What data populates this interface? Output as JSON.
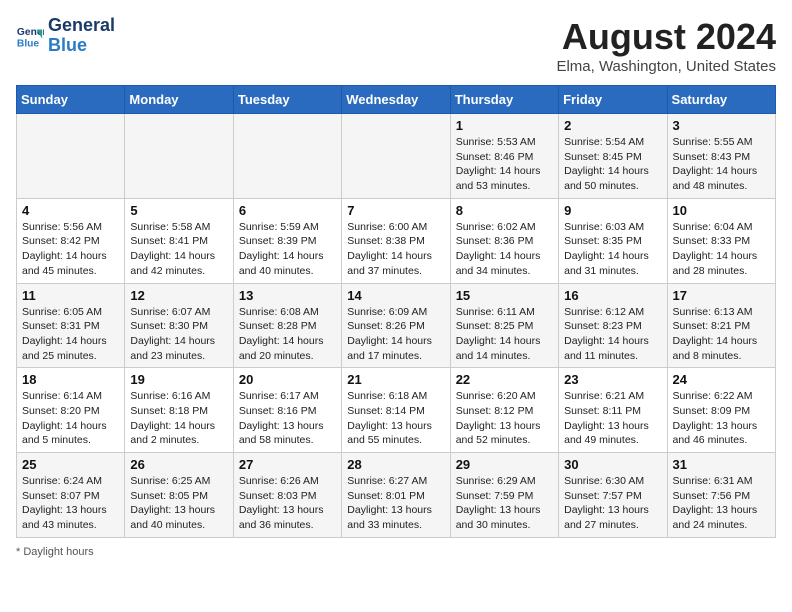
{
  "header": {
    "logo_line1": "General",
    "logo_line2": "Blue",
    "title": "August 2024",
    "subtitle": "Elma, Washington, United States"
  },
  "footer": {
    "note": "Daylight hours"
  },
  "weekdays": [
    "Sunday",
    "Monday",
    "Tuesday",
    "Wednesday",
    "Thursday",
    "Friday",
    "Saturday"
  ],
  "weeks": [
    [
      {
        "day": "",
        "sunrise": "",
        "sunset": "",
        "daylight": ""
      },
      {
        "day": "",
        "sunrise": "",
        "sunset": "",
        "daylight": ""
      },
      {
        "day": "",
        "sunrise": "",
        "sunset": "",
        "daylight": ""
      },
      {
        "day": "",
        "sunrise": "",
        "sunset": "",
        "daylight": ""
      },
      {
        "day": "1",
        "sunrise": "5:53 AM",
        "sunset": "8:46 PM",
        "daylight": "14 hours and 53 minutes."
      },
      {
        "day": "2",
        "sunrise": "5:54 AM",
        "sunset": "8:45 PM",
        "daylight": "14 hours and 50 minutes."
      },
      {
        "day": "3",
        "sunrise": "5:55 AM",
        "sunset": "8:43 PM",
        "daylight": "14 hours and 48 minutes."
      }
    ],
    [
      {
        "day": "4",
        "sunrise": "5:56 AM",
        "sunset": "8:42 PM",
        "daylight": "14 hours and 45 minutes."
      },
      {
        "day": "5",
        "sunrise": "5:58 AM",
        "sunset": "8:41 PM",
        "daylight": "14 hours and 42 minutes."
      },
      {
        "day": "6",
        "sunrise": "5:59 AM",
        "sunset": "8:39 PM",
        "daylight": "14 hours and 40 minutes."
      },
      {
        "day": "7",
        "sunrise": "6:00 AM",
        "sunset": "8:38 PM",
        "daylight": "14 hours and 37 minutes."
      },
      {
        "day": "8",
        "sunrise": "6:02 AM",
        "sunset": "8:36 PM",
        "daylight": "14 hours and 34 minutes."
      },
      {
        "day": "9",
        "sunrise": "6:03 AM",
        "sunset": "8:35 PM",
        "daylight": "14 hours and 31 minutes."
      },
      {
        "day": "10",
        "sunrise": "6:04 AM",
        "sunset": "8:33 PM",
        "daylight": "14 hours and 28 minutes."
      }
    ],
    [
      {
        "day": "11",
        "sunrise": "6:05 AM",
        "sunset": "8:31 PM",
        "daylight": "14 hours and 25 minutes."
      },
      {
        "day": "12",
        "sunrise": "6:07 AM",
        "sunset": "8:30 PM",
        "daylight": "14 hours and 23 minutes."
      },
      {
        "day": "13",
        "sunrise": "6:08 AM",
        "sunset": "8:28 PM",
        "daylight": "14 hours and 20 minutes."
      },
      {
        "day": "14",
        "sunrise": "6:09 AM",
        "sunset": "8:26 PM",
        "daylight": "14 hours and 17 minutes."
      },
      {
        "day": "15",
        "sunrise": "6:11 AM",
        "sunset": "8:25 PM",
        "daylight": "14 hours and 14 minutes."
      },
      {
        "day": "16",
        "sunrise": "6:12 AM",
        "sunset": "8:23 PM",
        "daylight": "14 hours and 11 minutes."
      },
      {
        "day": "17",
        "sunrise": "6:13 AM",
        "sunset": "8:21 PM",
        "daylight": "14 hours and 8 minutes."
      }
    ],
    [
      {
        "day": "18",
        "sunrise": "6:14 AM",
        "sunset": "8:20 PM",
        "daylight": "14 hours and 5 minutes."
      },
      {
        "day": "19",
        "sunrise": "6:16 AM",
        "sunset": "8:18 PM",
        "daylight": "14 hours and 2 minutes."
      },
      {
        "day": "20",
        "sunrise": "6:17 AM",
        "sunset": "8:16 PM",
        "daylight": "13 hours and 58 minutes."
      },
      {
        "day": "21",
        "sunrise": "6:18 AM",
        "sunset": "8:14 PM",
        "daylight": "13 hours and 55 minutes."
      },
      {
        "day": "22",
        "sunrise": "6:20 AM",
        "sunset": "8:12 PM",
        "daylight": "13 hours and 52 minutes."
      },
      {
        "day": "23",
        "sunrise": "6:21 AM",
        "sunset": "8:11 PM",
        "daylight": "13 hours and 49 minutes."
      },
      {
        "day": "24",
        "sunrise": "6:22 AM",
        "sunset": "8:09 PM",
        "daylight": "13 hours and 46 minutes."
      }
    ],
    [
      {
        "day": "25",
        "sunrise": "6:24 AM",
        "sunset": "8:07 PM",
        "daylight": "13 hours and 43 minutes."
      },
      {
        "day": "26",
        "sunrise": "6:25 AM",
        "sunset": "8:05 PM",
        "daylight": "13 hours and 40 minutes."
      },
      {
        "day": "27",
        "sunrise": "6:26 AM",
        "sunset": "8:03 PM",
        "daylight": "13 hours and 36 minutes."
      },
      {
        "day": "28",
        "sunrise": "6:27 AM",
        "sunset": "8:01 PM",
        "daylight": "13 hours and 33 minutes."
      },
      {
        "day": "29",
        "sunrise": "6:29 AM",
        "sunset": "7:59 PM",
        "daylight": "13 hours and 30 minutes."
      },
      {
        "day": "30",
        "sunrise": "6:30 AM",
        "sunset": "7:57 PM",
        "daylight": "13 hours and 27 minutes."
      },
      {
        "day": "31",
        "sunrise": "6:31 AM",
        "sunset": "7:56 PM",
        "daylight": "13 hours and 24 minutes."
      }
    ]
  ]
}
